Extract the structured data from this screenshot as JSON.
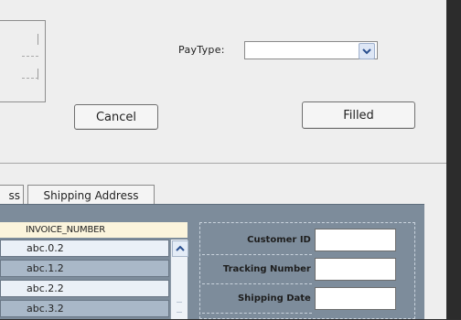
{
  "form": {
    "paytype_label": "PayType:",
    "paytype_value": "",
    "cancel_label": "Cancel",
    "filled_label": "Filled"
  },
  "tabs": [
    {
      "label": "ss"
    },
    {
      "label": "Shipping Address"
    }
  ],
  "invoice_list": {
    "header": "INVOICE_NUMBER",
    "rows": [
      "abc.0.2",
      "abc.1.2",
      "abc.2.2",
      "abc.3.2"
    ]
  },
  "details": {
    "customer_id_label": "Customer ID",
    "tracking_number_label": "Tracking Number",
    "shipping_date_label": "Shipping Date"
  },
  "colors": {
    "panel": "#7d8c9b",
    "header": "#fbf4dc",
    "row_light": "#eaf0f7",
    "row_dark": "#a9b8c8"
  },
  "icons": {
    "dropdown": "chevron-down-icon",
    "scroll_up": "chevron-up-icon"
  }
}
